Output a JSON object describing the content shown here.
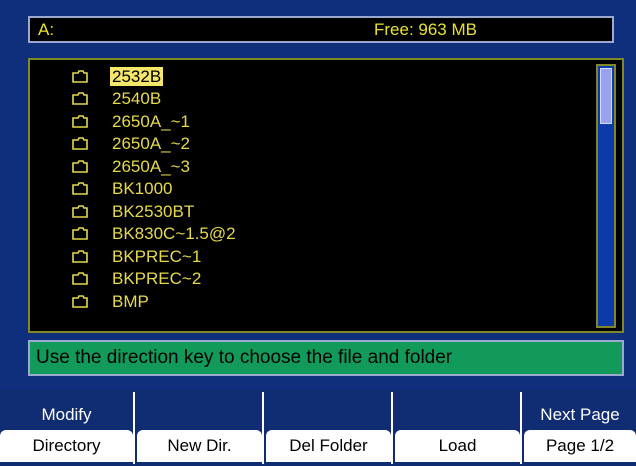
{
  "header": {
    "drive": "A:",
    "free": "Free: 963 MB"
  },
  "files": [
    {
      "name": "2532B",
      "selected": true
    },
    {
      "name": "2540B",
      "selected": false
    },
    {
      "name": "2650A_~1",
      "selected": false
    },
    {
      "name": "2650A_~2",
      "selected": false
    },
    {
      "name": "2650A_~3",
      "selected": false
    },
    {
      "name": "BK1000",
      "selected": false
    },
    {
      "name": "BK2530BT",
      "selected": false
    },
    {
      "name": "BK830C~1.5@2",
      "selected": false
    },
    {
      "name": "BKPREC~1",
      "selected": false
    },
    {
      "name": "BKPREC~2",
      "selected": false
    },
    {
      "name": "BMP",
      "selected": false
    }
  ],
  "status": {
    "message": "Use the direction key to choose the file and folder"
  },
  "softkeys": [
    {
      "top": "Modify",
      "bottom": "Directory"
    },
    {
      "top": "",
      "bottom": "New Dir."
    },
    {
      "top": "",
      "bottom": "Del Folder"
    },
    {
      "top": "",
      "bottom": "Load"
    },
    {
      "top": "Next Page",
      "bottom": "Page 1/2"
    }
  ],
  "colors": {
    "highlight": "#f4e76a",
    "text": "#e6d94a",
    "status_bg": "#119a5a"
  }
}
